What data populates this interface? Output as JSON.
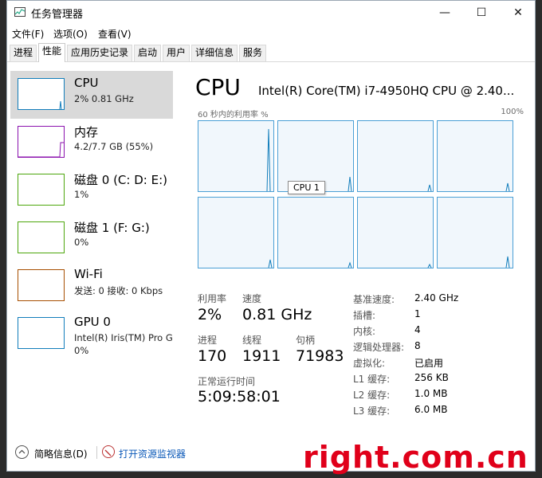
{
  "window": {
    "title": "任务管理器",
    "minimize_glyph": "—",
    "maximize_glyph": "☐",
    "close_glyph": "✕"
  },
  "menu": [
    "文件(F)",
    "选项(O)",
    "查看(V)"
  ],
  "tabs": [
    "进程",
    "性能",
    "应用历史记录",
    "启动",
    "用户",
    "详细信息",
    "服务"
  ],
  "active_tab": "性能",
  "sidebar": {
    "items": [
      {
        "name": "CPU",
        "sub": "2% 0.81 GHz",
        "color": "#117dbb",
        "selected": true
      },
      {
        "name": "内存",
        "sub": "4.2/7.7 GB (55%)",
        "color": "#8b12ae",
        "selected": false
      },
      {
        "name": "磁盘 0 (C: D: E:)",
        "sub": "1%",
        "color": "#4da60c",
        "selected": false
      },
      {
        "name": "磁盘 1 (F: G:)",
        "sub": "0%",
        "color": "#4da60c",
        "selected": false
      },
      {
        "name": "Wi-Fi",
        "sub": "发送: 0 接收: 0 Kbps",
        "color": "#a74f01",
        "selected": false
      },
      {
        "name": "GPU 0",
        "sub": "Intel(R) Iris(TM) Pro G",
        "sub2": "0%",
        "color": "#117dbb",
        "selected": false
      }
    ]
  },
  "main": {
    "title": "CPU",
    "model": "Intel(R) Core(TM) i7-4950HQ CPU @ 2.40...",
    "graph_label_left": "60 秒内的利用率 %",
    "graph_label_right": "100%",
    "tooltip": "CPU 1",
    "stats": {
      "utilization_label": "利用率",
      "utilization": "2%",
      "speed_label": "速度",
      "speed": "0.81 GHz",
      "processes_label": "进程",
      "processes": "170",
      "threads_label": "线程",
      "threads": "1911",
      "handles_label": "句柄",
      "handles": "71983",
      "uptime_label": "正常运行时间",
      "uptime": "5:09:58:01"
    },
    "specs": [
      {
        "label": "基准速度:",
        "value": "2.40 GHz"
      },
      {
        "label": "插槽:",
        "value": "1"
      },
      {
        "label": "内核:",
        "value": "4"
      },
      {
        "label": "逻辑处理器:",
        "value": "8"
      },
      {
        "label": "虚拟化:",
        "value": "已启用"
      },
      {
        "label": "L1 缓存:",
        "value": "256 KB"
      },
      {
        "label": "L2 缓存:",
        "value": "1.0 MB"
      },
      {
        "label": "L3 缓存:",
        "value": "6.0 MB"
      }
    ]
  },
  "footer": {
    "fewer_details": "简略信息(D)",
    "resource_monitor": "打开资源监视器"
  },
  "watermark": "right.com.cn"
}
